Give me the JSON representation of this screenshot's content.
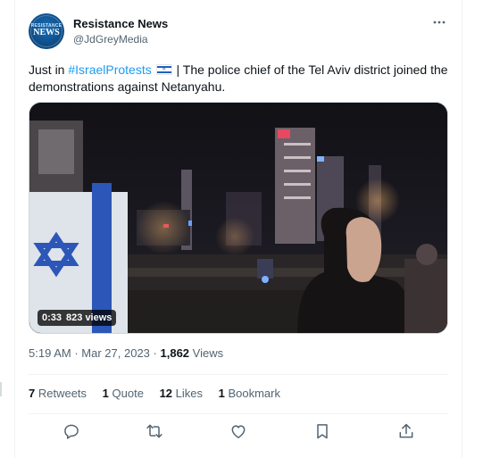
{
  "tweet": {
    "author_name": "Resistance News",
    "author_handle": "@JdGreyMedia",
    "avatar_text": {
      "line1": "RESISTANCE",
      "line2": "NEWS"
    },
    "text_prefix": "Just in ",
    "hashtag": "#IsraelProtests",
    "flag_icon": "israel-flag-emoji",
    "text_suffix": " | The police chief of the Tel Aviv district joined the demonstrations against Netanyahu.",
    "media": {
      "duration": "0:33",
      "views": "823 views"
    },
    "time": "5:19 AM",
    "dot": "·",
    "date": "Mar 27, 2023",
    "views_count": "1,862",
    "views_label": " Views",
    "stats": {
      "retweets": {
        "count": "7",
        "label": " Retweets"
      },
      "quotes": {
        "count": "1",
        "label": " Quote"
      },
      "likes": {
        "count": "12",
        "label": " Likes"
      },
      "bookmarks": {
        "count": "1",
        "label": " Bookmark"
      }
    },
    "actions": [
      "reply-icon",
      "retweet-icon",
      "like-icon",
      "bookmark-icon",
      "share-icon"
    ],
    "colors": {
      "link": "#1d9bf0",
      "secondary_text": "#536471",
      "primary_text": "#0f1419"
    }
  }
}
